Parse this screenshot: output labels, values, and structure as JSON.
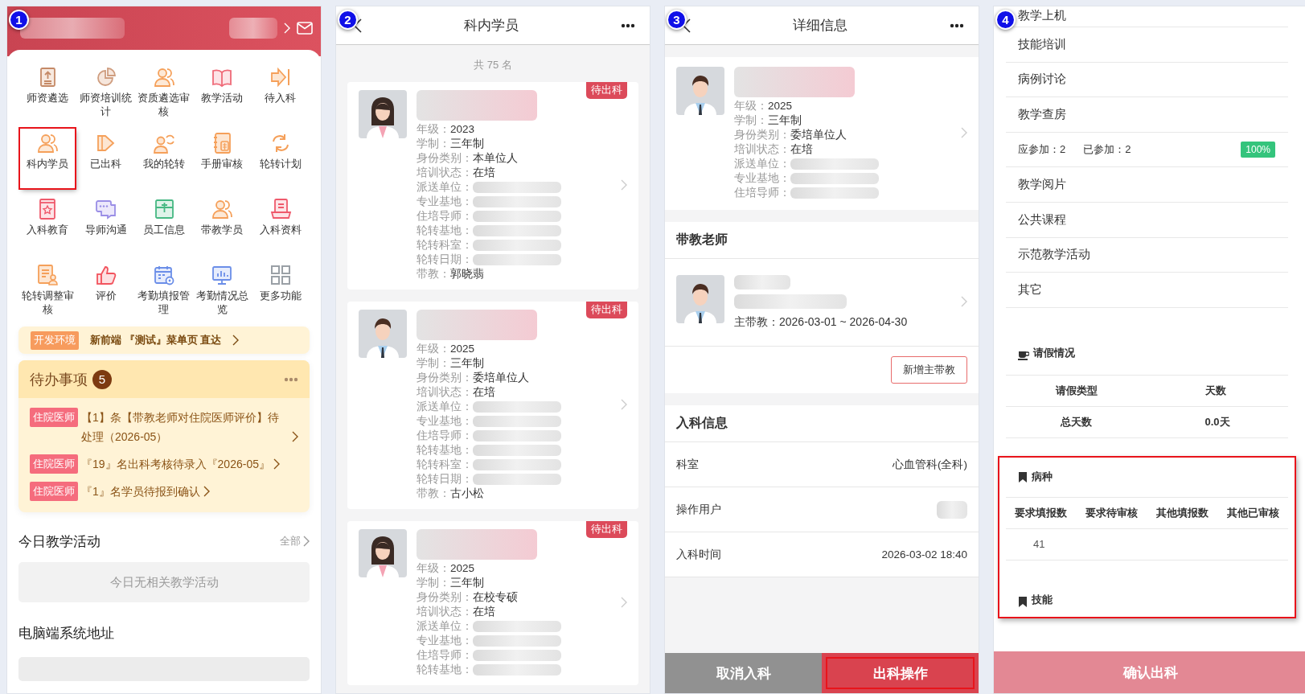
{
  "home": {
    "step": "1",
    "grid": [
      {
        "label": "师资遴选",
        "kind": "upload",
        "highlighted": false
      },
      {
        "label": "师资培训统计",
        "kind": "pie",
        "highlighted": false
      },
      {
        "label": "资质遴选审核",
        "kind": "people",
        "highlighted": false
      },
      {
        "label": "教学活动",
        "kind": "book",
        "highlighted": false
      },
      {
        "label": "待入科",
        "kind": "enter",
        "highlighted": false
      },
      {
        "label": "科内学员",
        "kind": "people",
        "highlighted": true
      },
      {
        "label": "已出科",
        "kind": "exit",
        "highlighted": false
      },
      {
        "label": "我的轮转",
        "kind": "person-rotate",
        "highlighted": false
      },
      {
        "label": "手册审核",
        "kind": "notebook",
        "highlighted": false
      },
      {
        "label": "轮转计划",
        "kind": "rotate",
        "highlighted": false
      },
      {
        "label": "入科教育",
        "kind": "edu-book",
        "highlighted": false
      },
      {
        "label": "导师沟通",
        "kind": "chat",
        "highlighted": false
      },
      {
        "label": "员工信息",
        "kind": "id-card",
        "highlighted": false
      },
      {
        "label": "带教学员",
        "kind": "people",
        "highlighted": false
      },
      {
        "label": "入科资料",
        "kind": "document",
        "highlighted": false
      },
      {
        "label": "轮转调整审核",
        "kind": "form-person",
        "highlighted": false
      },
      {
        "label": "评价",
        "kind": "thumb",
        "highlighted": false
      },
      {
        "label": "考勤填报管理",
        "kind": "calendar",
        "highlighted": false
      },
      {
        "label": "考勤情况总览",
        "kind": "monitor",
        "highlighted": false
      },
      {
        "label": "更多功能",
        "kind": "grid",
        "highlighted": false
      }
    ],
    "dev_banner": {
      "tag": "开发环境",
      "text": "新前端 『测试』菜单页 直达"
    },
    "todo": {
      "title": "待办事项",
      "count": "5",
      "items": [
        {
          "tag": "住院医师",
          "text": "【1】条【带教老师对住院医师评价】待处理（2026-05）"
        },
        {
          "tag": "住院医师",
          "text": "『19』名出科考核待录入『2026-05』"
        },
        {
          "tag": "住院医师",
          "text": "『1』名学员待报到确认"
        }
      ]
    },
    "today": {
      "title": "今日教学活动",
      "more": "全部",
      "empty": "今日无相关教学活动"
    },
    "pc_section": {
      "title": "电脑端系统地址"
    }
  },
  "student_list": {
    "step": "2",
    "title": "科内学员",
    "count": "共 75 名",
    "cards": [
      {
        "avatar": {
          "kind": "female"
        },
        "status": "待出科",
        "fields": [
          {
            "label": "年级：",
            "value": "2023"
          },
          {
            "label": "学制：",
            "value": "三年制"
          },
          {
            "label": "身份类别：",
            "value": "本单位人"
          },
          {
            "label": "培训状态：",
            "value": "在培"
          },
          {
            "label": "派送单位："
          },
          {
            "label": "专业基地："
          },
          {
            "label": "住培导师："
          },
          {
            "label": "轮转基地："
          },
          {
            "label": "轮转科室："
          },
          {
            "label": "轮转日期："
          },
          {
            "label": "带教：",
            "value": "郭晓翡"
          }
        ]
      },
      {
        "avatar": {
          "kind": "male"
        },
        "status": "待出科",
        "fields": [
          {
            "label": "年级：",
            "value": "2025"
          },
          {
            "label": "学制：",
            "value": "三年制"
          },
          {
            "label": "身份类别：",
            "value": "委培单位人"
          },
          {
            "label": "培训状态：",
            "value": "在培"
          },
          {
            "label": "派送单位："
          },
          {
            "label": "专业基地："
          },
          {
            "label": "住培导师："
          },
          {
            "label": "轮转基地："
          },
          {
            "label": "轮转科室："
          },
          {
            "label": "轮转日期："
          },
          {
            "label": "带教：",
            "value": "古小松"
          }
        ]
      },
      {
        "avatar": {
          "kind": "female"
        },
        "status": "待出科",
        "fields": [
          {
            "label": "年级：",
            "value": "2025"
          },
          {
            "label": "学制：",
            "value": "三年制"
          },
          {
            "label": "身份类别：",
            "value": "在校专硕"
          },
          {
            "label": "培训状态：",
            "value": "在培"
          },
          {
            "label": "派送单位："
          },
          {
            "label": "专业基地："
          },
          {
            "label": "住培导师："
          },
          {
            "label": "轮转基地："
          }
        ]
      }
    ]
  },
  "detail": {
    "step": "3",
    "title": "详细信息",
    "student": {
      "avatar": {
        "kind": "male"
      },
      "fields": [
        {
          "label": "年级：",
          "value": "2025"
        },
        {
          "label": "学制：",
          "value": "三年制"
        },
        {
          "label": "身份类别：",
          "value": "委培单位人"
        },
        {
          "label": "培训状态：",
          "value": "在培"
        },
        {
          "label": "派送单位："
        },
        {
          "label": "专业基地："
        },
        {
          "label": "住培导师："
        }
      ]
    },
    "teacher_section": {
      "title": "带教老师",
      "avatar": {
        "kind": "male"
      },
      "period": "主带教：2026-03-01 ~ 2026-04-30",
      "add_button": "新增主带教"
    },
    "entry_section": {
      "title": "入科信息",
      "rows": [
        {
          "label": "科室",
          "value": "心血管科(全科)"
        },
        {
          "label": "操作用户"
        },
        {
          "label": "入科时间",
          "value": "2026-03-02 18:40"
        }
      ]
    },
    "actions": [
      {
        "label": "取消入科",
        "kind": "secondary",
        "highlighted": false
      },
      {
        "label": "出科操作",
        "kind": "primary",
        "highlighted": true
      }
    ]
  },
  "exit": {
    "step": "4",
    "activities": [
      {
        "kind": "item",
        "label": "教学上机"
      },
      {
        "kind": "item",
        "label": "技能培训"
      },
      {
        "kind": "item",
        "label": "病例讨论"
      },
      {
        "kind": "item",
        "label": "教学查房"
      },
      {
        "kind": "stats",
        "required": "应参加：2",
        "attended": "已参加：2",
        "rate": "100%"
      },
      {
        "kind": "item",
        "label": "教学阅片"
      },
      {
        "kind": "item",
        "label": "公共课程"
      },
      {
        "kind": "item",
        "label": "示范教学活动"
      },
      {
        "kind": "item",
        "label": "其它"
      }
    ],
    "leave": {
      "title": "请假情况",
      "columns": [
        "请假类型",
        "天数"
      ],
      "rows": [
        [
          "总天数",
          "0.0天"
        ]
      ]
    },
    "cases": {
      "highlighted": true,
      "title": "病种",
      "columns": [
        "要求填报数",
        "要求待审核",
        "其他填报数",
        "其他已审核"
      ],
      "rows": [
        [
          "41"
        ]
      ],
      "skills_title": "技能"
    },
    "confirm_button": {
      "label": "确认出科",
      "disabled": true
    }
  }
}
